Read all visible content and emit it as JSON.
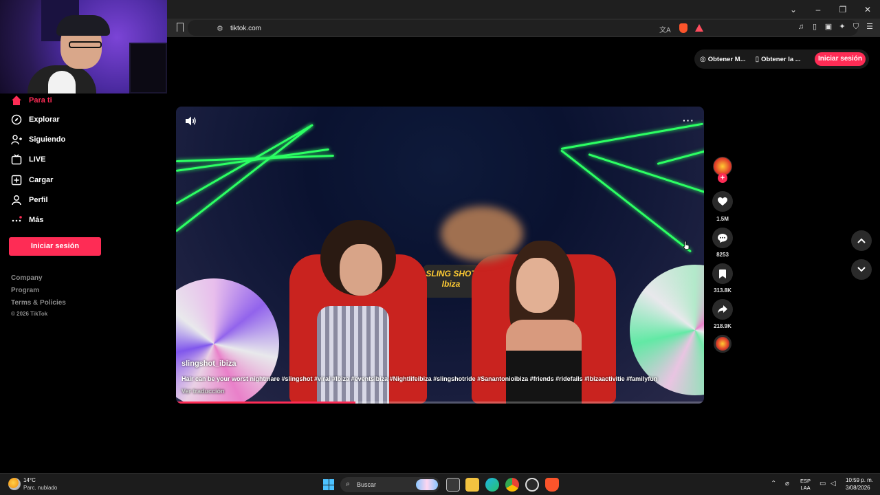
{
  "browser": {
    "url": "tiktok.com",
    "window_controls": [
      "⌄",
      "–",
      "❐",
      "✕"
    ]
  },
  "sidebar": {
    "items": [
      {
        "label": "Para ti",
        "icon": "home-icon",
        "active": true
      },
      {
        "label": "Explorar",
        "icon": "compass-icon"
      },
      {
        "label": "Siguiendo",
        "icon": "following-user-icon"
      },
      {
        "label": "LIVE",
        "icon": "live-tv-icon"
      },
      {
        "label": "Cargar",
        "icon": "upload-plus-icon"
      },
      {
        "label": "Perfil",
        "icon": "profile-icon"
      },
      {
        "label": "Más",
        "icon": "more-dots-icon"
      }
    ],
    "login_label": "Iniciar sesión",
    "footer": [
      "Company",
      "Program",
      "Terms & Policies"
    ],
    "copyright": "© 2026 TikTok"
  },
  "top_actions": {
    "get_coins": "Obtener M...",
    "get_app": "Obtener la ...",
    "login": "Iniciar sesión"
  },
  "video": {
    "sign_text_line1": "SLING SHOT",
    "sign_text_line2": "Ibiza",
    "author": "slingshot_ibiza",
    "caption": "Hair can be your worst nightmare #slingshot #viral #Ibiza #eventsibiza #Nightlifeibiza #slingshotride #Sanantonioibiza #friends #ridefails #Ibizaactivitie #familyfun",
    "translate_label": "Ver traducción",
    "progress": 0.34
  },
  "actions": {
    "likes": "1.5M",
    "comments": "8253",
    "saves": "313.8K",
    "shares": "218.9K"
  },
  "taskbar": {
    "temperature": "14°C",
    "weather": "Parc. nublado",
    "search_label": "Buscar",
    "lang_line1": "ESP",
    "lang_line2": "LAA",
    "time": "10:59 p. m.",
    "date": "3/08/2026"
  },
  "colors": {
    "accent": "#fe2c55",
    "laser": "#2cff63",
    "seat": "#c9231f"
  }
}
